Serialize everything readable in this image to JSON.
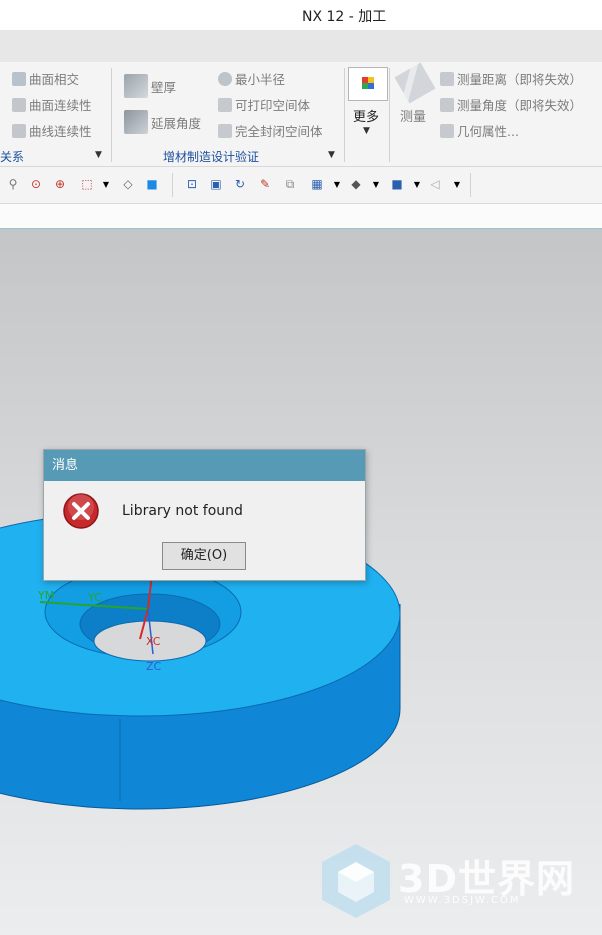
{
  "window": {
    "title": "NX 12 - 加工"
  },
  "ribbon": {
    "left_items": [
      "曲面相交",
      "曲面连续性",
      "曲线连续性"
    ],
    "left_group_label": "关系",
    "am_col1": [
      "壁厚",
      "延展角度"
    ],
    "am_col2": [
      "最小半径",
      "可打印空间体",
      "完全封闭空间体"
    ],
    "am_group_label": "增材制造设计验证",
    "more_label": "更多",
    "measure_label": "测量",
    "measure_items": [
      "测量距离（即将失效）",
      "测量角度（即将失效）",
      "几何属性..."
    ]
  },
  "viewport": {
    "axis_labels": [
      "YM",
      "YC",
      "XC",
      "ZC"
    ]
  },
  "dialog": {
    "title": "消息",
    "message": "Library not found",
    "ok_label": "确定(O)"
  },
  "watermark": {
    "text": "3D世界网",
    "url": "WWW.3DSJW.COM"
  },
  "colors": {
    "part_top": "#1fb1f0",
    "part_side": "#0f86d6",
    "dialog_header": "#579ab6",
    "error": "#c8282c"
  }
}
